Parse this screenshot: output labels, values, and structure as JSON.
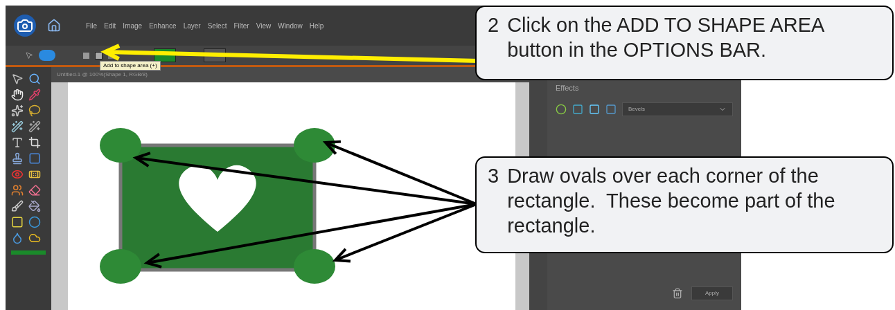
{
  "menu_bar": {
    "items": [
      "File",
      "Edit",
      "Image",
      "Enhance",
      "Layer",
      "Select",
      "Filter",
      "View",
      "Window",
      "Help"
    ]
  },
  "options_bar": {
    "tooltip": "Add to shape area (+)"
  },
  "document": {
    "title": "Untitled-1 @ 100%(Shape 1, RGB/8)"
  },
  "effects_panel": {
    "title": "Effects",
    "dropdown": "Bevels",
    "apply_button": "Apply"
  },
  "callouts": [
    {
      "number": "2",
      "text": "Click on the ADD TO SHAPE AREA button in the OPTIONS BAR."
    },
    {
      "number": "3",
      "text": "Draw ovals over each corner of the rectangle.  These become part of the rectangle."
    }
  ]
}
